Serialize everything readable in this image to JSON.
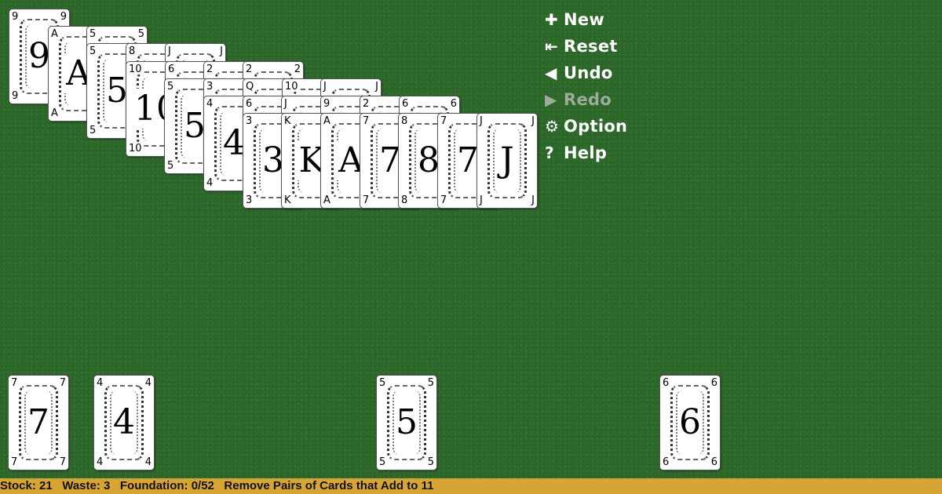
{
  "pyramid": [
    [
      "9"
    ],
    [
      "A",
      "5"
    ],
    [
      "5",
      "8",
      "J"
    ],
    [
      "10",
      "6",
      "2",
      "2"
    ],
    [
      "5",
      "3",
      "Q",
      "10",
      "J"
    ],
    [
      "4",
      "6",
      "J",
      "9",
      "2",
      "6"
    ],
    [
      "3",
      "K",
      "A",
      "7",
      "8",
      "7",
      "J"
    ]
  ],
  "stock_cards": [
    {
      "rank": "7",
      "name": "stock-card"
    },
    {
      "rank": "4",
      "name": "waste-card"
    }
  ],
  "foundation_card": {
    "rank": "5"
  },
  "extra_card": {
    "rank": "6"
  },
  "menu": {
    "new_label": "New",
    "reset_label": "Reset",
    "undo_label": "Undo",
    "redo_label": "Redo",
    "option_label": "Option",
    "help_label": "Help",
    "redo_enabled": false
  },
  "status": {
    "stock_label": "Stock:",
    "stock_value": "21",
    "waste_label": "Waste:",
    "waste_value": "3",
    "foundation_label": "Foundation:",
    "foundation_value": "0/52",
    "instruction": "Remove Pairs of Cards that Add to 11"
  },
  "colors": {
    "felt": "#2d6a2a",
    "status_bar": "#d7a533",
    "menu_text": "#ffffff",
    "menu_disabled": "#9cab9a"
  }
}
